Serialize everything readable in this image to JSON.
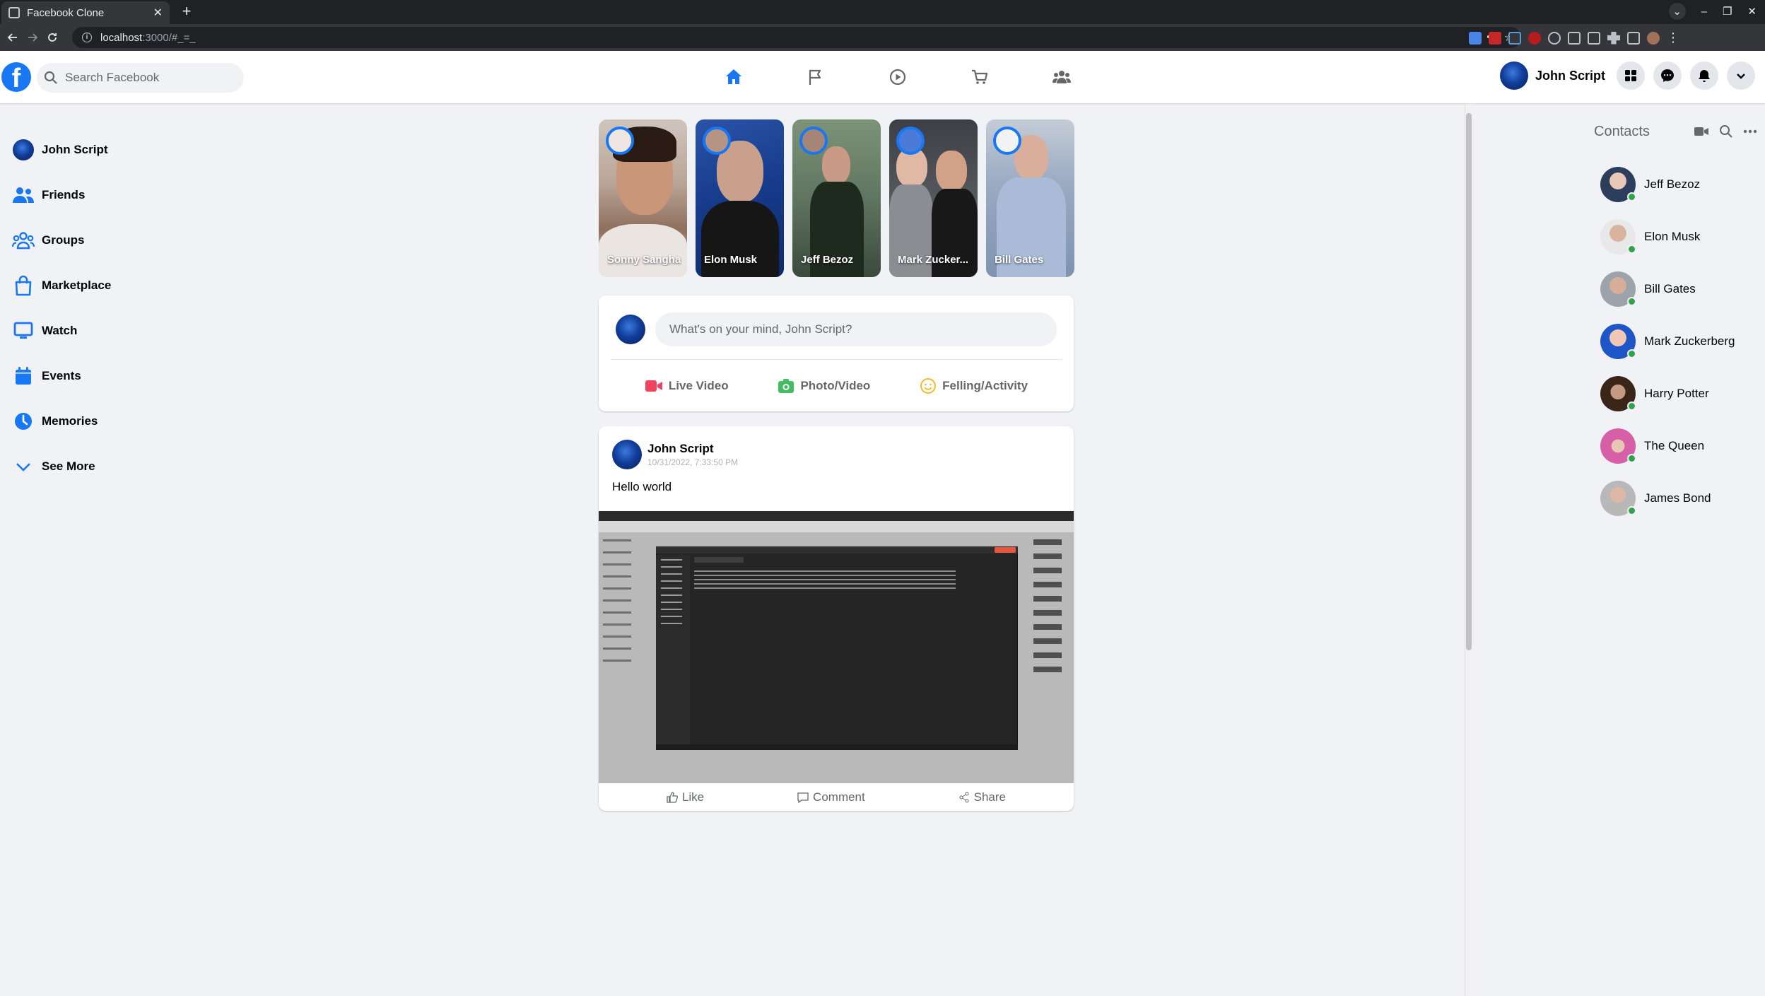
{
  "browser": {
    "tab_title": "Facebook Clone",
    "url_host": "localhost",
    "url_path": ":3000/#_=_"
  },
  "header": {
    "logo": "f",
    "search_placeholder": "Search Facebook",
    "profile_name": "John Script"
  },
  "sidebar": {
    "items": [
      {
        "label": "John Script",
        "icon": "avatar"
      },
      {
        "label": "Friends",
        "icon": "friends-icon"
      },
      {
        "label": "Groups",
        "icon": "groups-icon"
      },
      {
        "label": "Marketplace",
        "icon": "marketplace-icon"
      },
      {
        "label": "Watch",
        "icon": "watch-icon"
      },
      {
        "label": "Events",
        "icon": "events-icon"
      },
      {
        "label": "Memories",
        "icon": "memories-icon"
      },
      {
        "label": "See More",
        "icon": "chevron-down-icon"
      }
    ]
  },
  "stories": [
    {
      "name": "Sonny Sangha"
    },
    {
      "name": "Elon Musk"
    },
    {
      "name": "Jeff Bezoz"
    },
    {
      "name": "Mark Zucker..."
    },
    {
      "name": "Bill Gates"
    }
  ],
  "composer": {
    "placeholder": "What's on your mind, John Script?",
    "actions": [
      "Live Video",
      "Photo/Video",
      "Felling/Activity"
    ]
  },
  "post": {
    "author": "John Script",
    "timestamp": "10/31/2022, 7:33:50 PM",
    "text": "Hello world",
    "actions": [
      "Like",
      "Comment",
      "Share"
    ]
  },
  "contacts": {
    "title": "Contacts",
    "people": [
      "Jeff Bezoz",
      "Elon Musk",
      "Bill Gates",
      "Mark Zuckerberg",
      "Harry Potter",
      "The Queen",
      "James Bond"
    ]
  },
  "colors": {
    "brand": "#1877f2",
    "online": "#31a24c",
    "background": "#f0f2f5"
  }
}
